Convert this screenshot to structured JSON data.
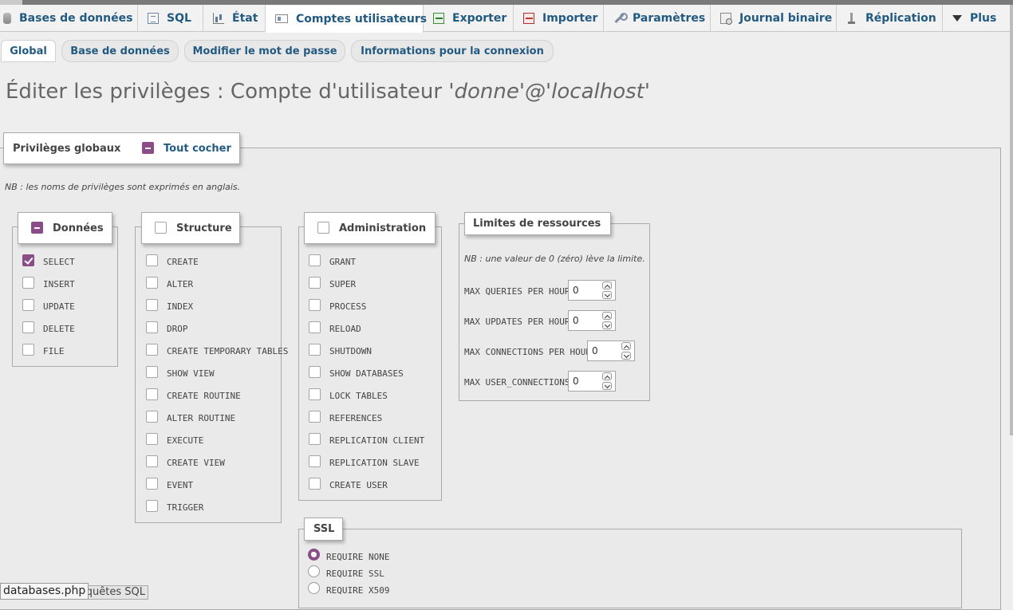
{
  "menu": [
    {
      "label": "Bases de données",
      "icon": "database-icon",
      "active": false
    },
    {
      "label": "SQL",
      "icon": "sql-icon",
      "active": false
    },
    {
      "label": "État",
      "icon": "status-chart-icon",
      "active": false
    },
    {
      "label": "Comptes utilisateurs",
      "icon": "user-accounts-icon",
      "active": true
    },
    {
      "label": "Exporter",
      "icon": "export-icon",
      "active": false
    },
    {
      "label": "Importer",
      "icon": "import-icon",
      "active": false
    },
    {
      "label": "Paramètres",
      "icon": "wrench-icon",
      "active": false
    },
    {
      "label": "Journal binaire",
      "icon": "binary-log-icon",
      "active": false
    },
    {
      "label": "Réplication",
      "icon": "replication-icon",
      "active": false
    },
    {
      "label": "Plus",
      "icon": "triangle-down-icon",
      "active": false
    }
  ],
  "subtabs": [
    {
      "label": "Global",
      "active": true
    },
    {
      "label": "Base de données",
      "active": false
    },
    {
      "label": "Modifier le mot de passe",
      "active": false
    },
    {
      "label": "Informations pour la connexion",
      "active": false
    }
  ],
  "page": {
    "title_prefix": "Éditer les privilèges : Compte d'utilisateur ",
    "title_account": "'donne'@'localhost'"
  },
  "global_privileges": {
    "legend": "Privilèges globaux",
    "check_all": "Tout cocher",
    "note": "NB : les noms de privilèges sont exprimés en anglais."
  },
  "groups": {
    "data": {
      "legend": "Données",
      "state": "indeterminate",
      "items": [
        {
          "label": "SELECT",
          "checked": true
        },
        {
          "label": "INSERT",
          "checked": false
        },
        {
          "label": "UPDATE",
          "checked": false
        },
        {
          "label": "DELETE",
          "checked": false
        },
        {
          "label": "FILE",
          "checked": false
        }
      ]
    },
    "structure": {
      "legend": "Structure",
      "state": "unchecked",
      "items": [
        {
          "label": "CREATE",
          "checked": false
        },
        {
          "label": "ALTER",
          "checked": false
        },
        {
          "label": "INDEX",
          "checked": false
        },
        {
          "label": "DROP",
          "checked": false
        },
        {
          "label": "CREATE TEMPORARY TABLES",
          "checked": false
        },
        {
          "label": "SHOW VIEW",
          "checked": false
        },
        {
          "label": "CREATE ROUTINE",
          "checked": false
        },
        {
          "label": "ALTER ROUTINE",
          "checked": false
        },
        {
          "label": "EXECUTE",
          "checked": false
        },
        {
          "label": "CREATE VIEW",
          "checked": false
        },
        {
          "label": "EVENT",
          "checked": false
        },
        {
          "label": "TRIGGER",
          "checked": false
        }
      ]
    },
    "admin": {
      "legend": "Administration",
      "state": "unchecked",
      "items": [
        {
          "label": "GRANT",
          "checked": false
        },
        {
          "label": "SUPER",
          "checked": false
        },
        {
          "label": "PROCESS",
          "checked": false
        },
        {
          "label": "RELOAD",
          "checked": false
        },
        {
          "label": "SHUTDOWN",
          "checked": false
        },
        {
          "label": "SHOW DATABASES",
          "checked": false
        },
        {
          "label": "LOCK TABLES",
          "checked": false
        },
        {
          "label": "REFERENCES",
          "checked": false
        },
        {
          "label": "REPLICATION CLIENT",
          "checked": false
        },
        {
          "label": "REPLICATION SLAVE",
          "checked": false
        },
        {
          "label": "CREATE USER",
          "checked": false
        }
      ]
    }
  },
  "limits": {
    "legend": "Limites de ressources",
    "note": "NB : une valeur de 0 (zéro) lève la limite.",
    "items": [
      {
        "label": "MAX QUERIES PER HOUR",
        "value": "0"
      },
      {
        "label": "MAX UPDATES PER HOUR",
        "value": "0"
      },
      {
        "label": "MAX CONNECTIONS PER HOUR",
        "value": "0"
      },
      {
        "label": "MAX USER_CONNECTIONS",
        "value": "0"
      }
    ]
  },
  "ssl": {
    "legend": "SSL",
    "options": [
      {
        "label": "REQUIRE NONE",
        "selected": true
      },
      {
        "label": "REQUIRE SSL",
        "selected": false
      },
      {
        "label": "REQUIRE X509",
        "selected": false
      }
    ]
  },
  "statusbar": {
    "url": "databases.php",
    "console": "Requêtes SQL"
  },
  "colors": {
    "accent": "#8a4d88",
    "link": "#235a81"
  }
}
